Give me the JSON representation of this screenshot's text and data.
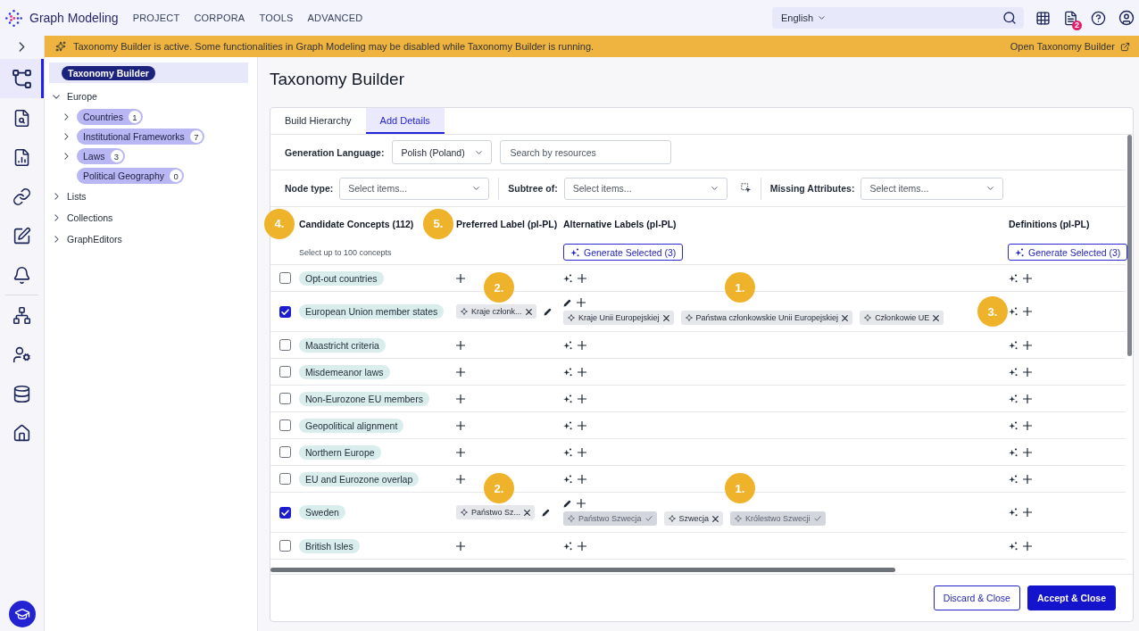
{
  "app": {
    "title": "Graph Modeling",
    "nav": [
      "PROJECT",
      "CORPORA",
      "TOOLS",
      "ADVANCED"
    ],
    "language": "English",
    "notifications": "2"
  },
  "rail": {
    "groups": [
      {
        "items": [
          {
            "kind": "hierarchy",
            "selected": true
          },
          {
            "kind": "file-search",
            "selected": false
          },
          {
            "kind": "file-chart",
            "selected": false
          },
          {
            "kind": "link",
            "selected": false
          },
          {
            "kind": "edit",
            "selected": false
          },
          {
            "kind": "bell",
            "selected": false
          }
        ]
      },
      {
        "items": [
          {
            "kind": "sitemap",
            "selected": false
          },
          {
            "kind": "user-settings",
            "selected": false
          },
          {
            "kind": "database",
            "selected": false
          },
          {
            "kind": "home",
            "selected": false
          }
        ]
      }
    ]
  },
  "banner": {
    "message": "Taxonomy Builder is active. Some functionalities in Graph Modeling may be disabled while Taxonomy Builder is running.",
    "link": "Open Taxonomy Builder"
  },
  "tree": {
    "items": [
      {
        "label": "Taxonomy Builder",
        "kind": "builder",
        "selected": true
      },
      {
        "label": "Europe",
        "kind": "folder",
        "selected": false,
        "expanded": true,
        "children": [
          {
            "label": "Countries",
            "kind": "group",
            "count": "1",
            "selected": false,
            "expanded": false
          },
          {
            "label": "Institutional Frameworks",
            "kind": "group",
            "count": "7",
            "selected": false,
            "expanded": false
          },
          {
            "label": "Laws",
            "kind": "group",
            "count": "3",
            "selected": false,
            "expanded": false
          },
          {
            "label": "Political Geography",
            "kind": "group",
            "count": "0",
            "selected": false
          }
        ]
      },
      {
        "label": "Lists",
        "kind": "folder",
        "selected": false,
        "expanded": false
      },
      {
        "label": "Collections",
        "kind": "folder",
        "selected": false,
        "expanded": false
      },
      {
        "label": "GraphEditors",
        "kind": "folder",
        "selected": false,
        "expanded": false
      }
    ]
  },
  "page": {
    "title": "Taxonomy Builder"
  },
  "tabs": [
    {
      "label": "Build Hierarchy",
      "selected": false
    },
    {
      "label": "Add Details",
      "selected": true
    }
  ],
  "generation": {
    "label": "Generation Language:",
    "value": "Polish (Poland)",
    "search_placeholder": "Search by resources"
  },
  "filters": [
    {
      "label": "Node type:",
      "placeholder": "Select items...",
      "picker": false
    },
    {
      "label": "Subtree of:",
      "placeholder": "Select items...",
      "picker": true
    },
    {
      "label": "Missing Attributes:",
      "placeholder": "Select items...",
      "picker": false
    }
  ],
  "table": {
    "columns": [
      {
        "title": "Candidate Concepts (112)",
        "marker": "4.",
        "note": "Select up to 100 concepts"
      },
      {
        "title": "Preferred Label (pl-PL)",
        "marker": "5."
      },
      {
        "title": "Alternative Labels (pl-PL)",
        "action": "Generate Selected (3)"
      },
      {
        "title": "Definitions (pl-PL)",
        "action": "Generate Selected (3)"
      }
    ],
    "rows": [
      {
        "checked": false,
        "concept": "Opt-out countries"
      },
      {
        "checked": true,
        "concept": "European Union member states",
        "preferred_label": "Kraje członk...",
        "alternative_labels": [
          {
            "text": "Kraje Unii Europejskiej",
            "kind": "removable"
          },
          {
            "text": "Państwa członkowskie Unii Europejskiej",
            "kind": "removable"
          },
          {
            "text": "Członkowie UE",
            "kind": "removable"
          }
        ],
        "markers": {
          "preferred": "2.",
          "alternative": "1.",
          "definitions": "3."
        }
      },
      {
        "checked": false,
        "concept": "Maastricht criteria"
      },
      {
        "checked": false,
        "concept": "Misdemeanor laws"
      },
      {
        "checked": false,
        "concept": "Non-Eurozone EU members"
      },
      {
        "checked": false,
        "concept": "Geopolitical alignment"
      },
      {
        "checked": false,
        "concept": "Northern Europe"
      },
      {
        "checked": false,
        "concept": "EU and Eurozone overlap"
      },
      {
        "checked": true,
        "concept": "Sweden",
        "preferred_label": "Państwo Sz...",
        "alternative_labels": [
          {
            "text": "Państwo Szwecja",
            "kind": "accepted"
          },
          {
            "text": "Szwecja",
            "kind": "removable"
          },
          {
            "text": "Królestwo Szwecji",
            "kind": "accepted"
          }
        ],
        "markers": {
          "preferred": "2.",
          "alternative": "1."
        }
      },
      {
        "checked": false,
        "concept": "British Isles"
      }
    ]
  },
  "footer": {
    "buttons": [
      {
        "label": "Discard & Close",
        "kind": "secondary"
      },
      {
        "label": "Accept & Close",
        "kind": "primary"
      }
    ]
  }
}
